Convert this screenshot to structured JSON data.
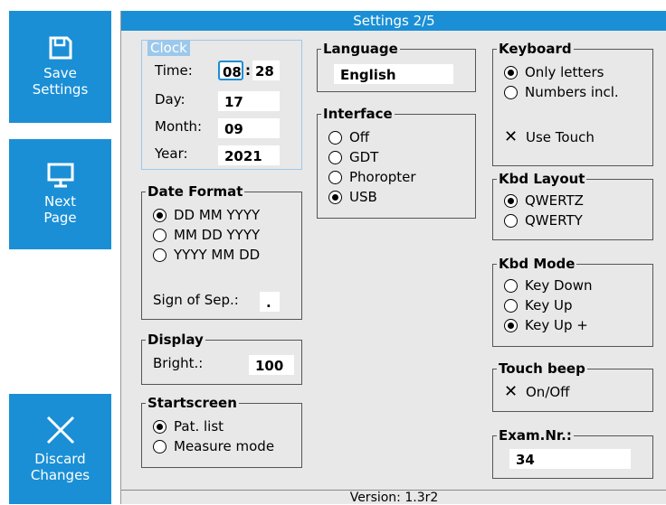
{
  "sidebar": {
    "save_label": "Save\nSettings",
    "next_label": "Next\nPage",
    "discard_label": "Discard\nChanges"
  },
  "title": "Settings 2/5",
  "footer": "Version: 1.3r2",
  "clock": {
    "legend": "Clock",
    "time_label": "Time:",
    "hour": "08",
    "colon": ":",
    "minute": "28",
    "day_label": "Day:",
    "day": "17",
    "month_label": "Month:",
    "month": "09",
    "year_label": "Year:",
    "year": "2021"
  },
  "date_format": {
    "legend": "Date Format",
    "options": [
      "DD MM YYYY",
      "MM DD YYYY",
      "YYYY MM DD"
    ],
    "selected": 0,
    "sep_label": "Sign of Sep.:",
    "sep_value": "."
  },
  "display": {
    "legend": "Display",
    "bright_label": "Bright.:",
    "bright_value": "100"
  },
  "startscreen": {
    "legend": "Startscreen",
    "options": [
      "Pat. list",
      "Measure mode"
    ],
    "selected": 0
  },
  "language": {
    "legend": "Language",
    "value": "English"
  },
  "interface": {
    "legend": "Interface",
    "options": [
      "Off",
      "GDT",
      "Phoropter",
      "USB"
    ],
    "selected": 3
  },
  "keyboard": {
    "legend": "Keyboard",
    "options": [
      "Only letters",
      "Numbers incl."
    ],
    "selected": 0,
    "touch_label": "Use Touch"
  },
  "kbd_layout": {
    "legend": "Kbd Layout",
    "options": [
      "QWERTZ",
      "QWERTY"
    ],
    "selected": 0
  },
  "kbd_mode": {
    "legend": "Kbd Mode",
    "options": [
      "Key Down",
      "Key Up",
      "Key Up +"
    ],
    "selected": 2
  },
  "touch_beep": {
    "legend": "Touch beep",
    "label": "On/Off"
  },
  "exam_nr": {
    "legend": "Exam.Nr.:",
    "value": "34"
  },
  "colors": {
    "accent": "#1a8fd6",
    "panel": "#e8e8e8",
    "clock_border": "#9cc8ec"
  }
}
